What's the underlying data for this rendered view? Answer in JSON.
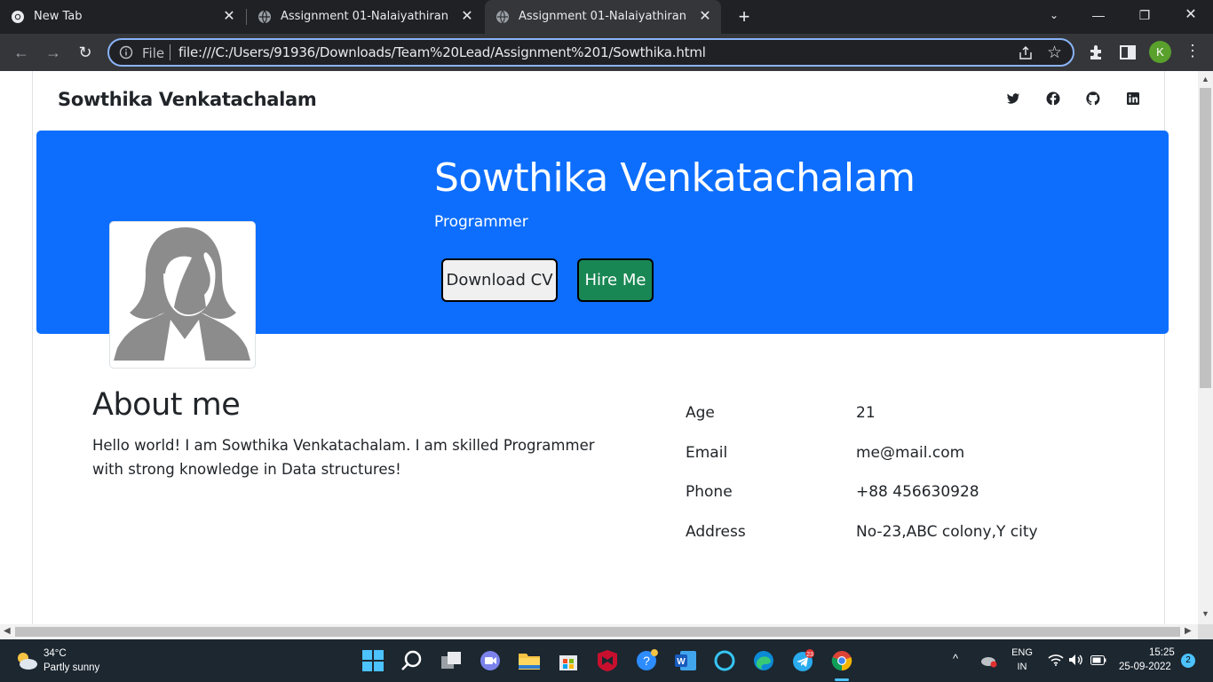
{
  "browser": {
    "tabs": [
      {
        "title": "New Tab"
      },
      {
        "title": "Assignment 01-Nalaiyathiran"
      },
      {
        "title": "Assignment 01-Nalaiyathiran"
      }
    ],
    "omnibox": {
      "scheme_label": "File",
      "url": "file:///C:/Users/91936/Downloads/Team%20Lead/Assignment%201/Sowthika.html"
    },
    "profile_initial": "K"
  },
  "page": {
    "brand": "Sowthika Venkatachalam",
    "social_icons": [
      "twitter-icon",
      "facebook-icon",
      "github-icon",
      "linkedin-icon"
    ],
    "hero": {
      "name": "Sowthika Venkatachalam",
      "role": "Programmer",
      "download_cv": "Download CV",
      "hire_me": "Hire Me"
    },
    "about": {
      "title": "About me",
      "text": "Hello world! I am Sowthika Venkatachalam. I am skilled Programmer with strong knowledge in Data structures!"
    },
    "info": [
      {
        "label": "Age",
        "value": "21"
      },
      {
        "label": "Email",
        "value": "me@mail.com"
      },
      {
        "label": "Phone",
        "value": "+88 456630928"
      },
      {
        "label": "Address",
        "value": "No-23,ABC colony,Y city"
      }
    ],
    "colors": {
      "hero_bg": "#0d6efd",
      "hire_bg": "#198754"
    }
  },
  "taskbar": {
    "weather_temp": "34°C",
    "weather_desc": "Partly sunny",
    "lang_top": "ENG",
    "lang_bottom": "IN",
    "time": "15:25",
    "date": "25-09-2022",
    "notifications": "2",
    "telegram_badge": "23"
  }
}
